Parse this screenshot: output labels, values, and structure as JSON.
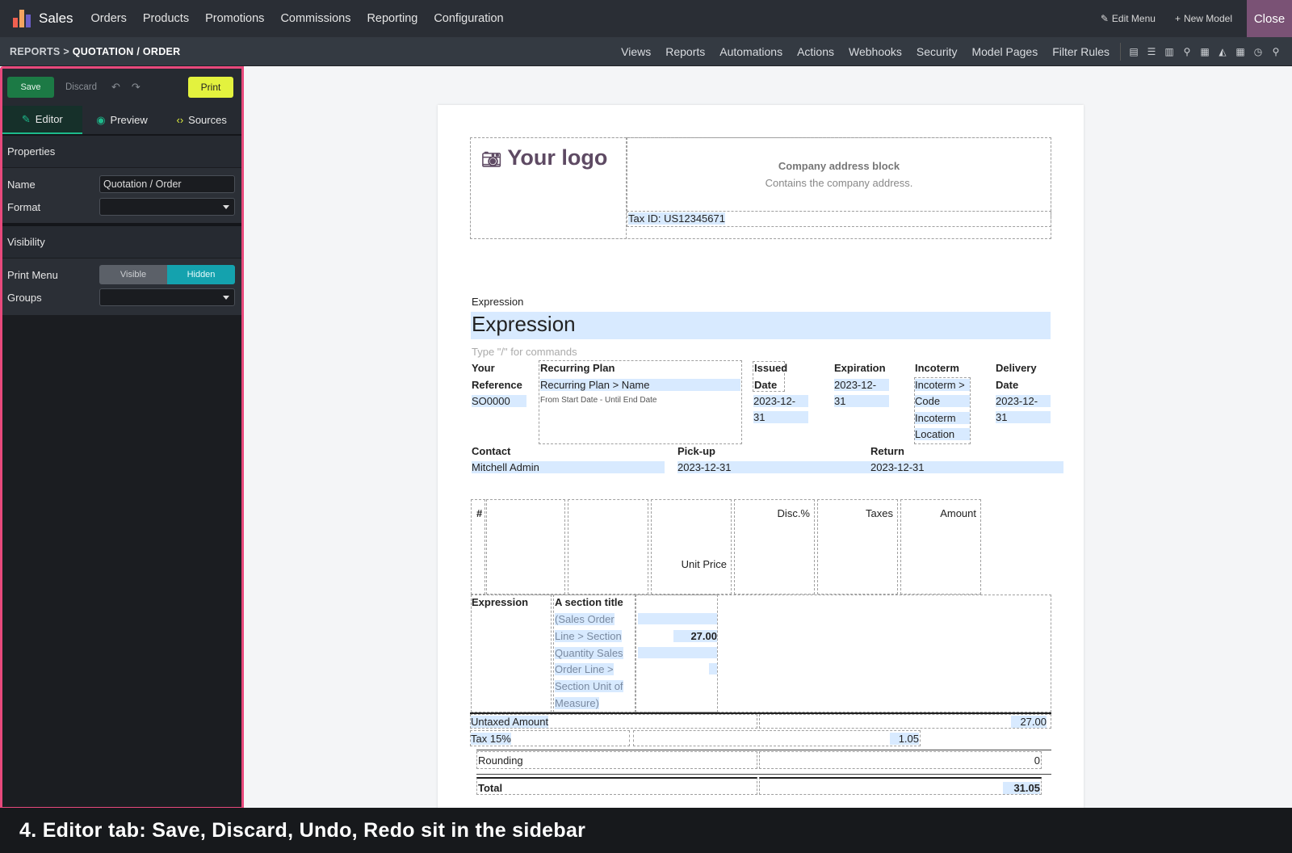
{
  "topbar": {
    "app_name": "Sales",
    "menu": [
      "Orders",
      "Products",
      "Promotions",
      "Commissions",
      "Reporting",
      "Configuration"
    ],
    "edit_menu": "Edit Menu",
    "new_model": "New Model",
    "close": "Close",
    "icon_colors": [
      "#f06050",
      "#f4a460",
      "#6c5fc7"
    ]
  },
  "subbar": {
    "breadcrumb_parent": "REPORTS",
    "breadcrumb_sep": ">",
    "breadcrumb_current": "QUOTATION / ORDER",
    "links": [
      "Views",
      "Reports",
      "Automations",
      "Actions",
      "Webhooks",
      "Security",
      "Model Pages",
      "Filter Rules"
    ]
  },
  "sidebar": {
    "save": "Save",
    "discard": "Discard",
    "undo_icon": "undo-icon",
    "redo_icon": "redo-icon",
    "print": "Print",
    "tabs": [
      "Editor",
      "Preview",
      "Sources"
    ],
    "properties_title": "Properties",
    "name_label": "Name",
    "name_value": "Quotation / Order",
    "format_label": "Format",
    "format_value": "",
    "visibility_title": "Visibility",
    "print_menu_label": "Print Menu",
    "visible": "Visible",
    "hidden": "Hidden",
    "groups_label": "Groups",
    "groups_value": ""
  },
  "report": {
    "logo": "Your logo",
    "address_title": "Company address block",
    "address_sub": "Contains the company address.",
    "tax_id": "Tax ID: US12345671",
    "expr_small": "Expression",
    "expr_big": "Expression",
    "commands_hint": "Type \"/\" for commands",
    "your_ref_label_1": "Your",
    "your_ref_label_2": "Reference",
    "your_ref_value": "SO0000",
    "recurring_label": "Recurring Plan",
    "recurring_value": "Recurring Plan > Name",
    "recurring_range": "From Start Date - Until End Date",
    "issued_label_1": "Issued",
    "issued_label_2": "Date",
    "issued_value_1": "2023-12-",
    "issued_value_2": "31",
    "expiration_label": "Expiration",
    "expiration_value_1": "2023-12-",
    "expiration_value_2": "31",
    "incoterm_label": "Incoterm",
    "incoterm_lines": [
      "Incoterm >",
      "Code",
      "Incoterm",
      "Location"
    ],
    "delivery_label_1": "Delivery",
    "delivery_label_2": "Date",
    "delivery_value_1": "2023-12-",
    "delivery_value_2": "31",
    "contact_label": "Contact",
    "contact_value": "Mitchell Admin",
    "pickup_label": "Pick-up",
    "pickup_value": "2023-12-31",
    "return_label": "Return",
    "return_value": "2023-12-31",
    "th_num": "#",
    "th_unit_price": "Unit Price",
    "th_disc": "Disc.%",
    "th_taxes": "Taxes",
    "th_amount": "Amount",
    "row_expression": "Expression",
    "section_title": "A section title",
    "section_lines": [
      "(Sales Order",
      "Line > Section",
      "Quantity Sales",
      "Order Line >",
      "Section Unit of",
      "Measure)"
    ],
    "section_amount": "27.00",
    "untaxed_label": "Untaxed Amount",
    "untaxed_value": "27.00",
    "tax_label": "Tax 15%",
    "tax_value": "1.05",
    "rounding_label": "Rounding",
    "rounding_value": "0",
    "total_label": "Total",
    "total_value": "31.05"
  },
  "caption": "4. Editor tab: Save, Discard, Undo, Redo sit in the sidebar"
}
